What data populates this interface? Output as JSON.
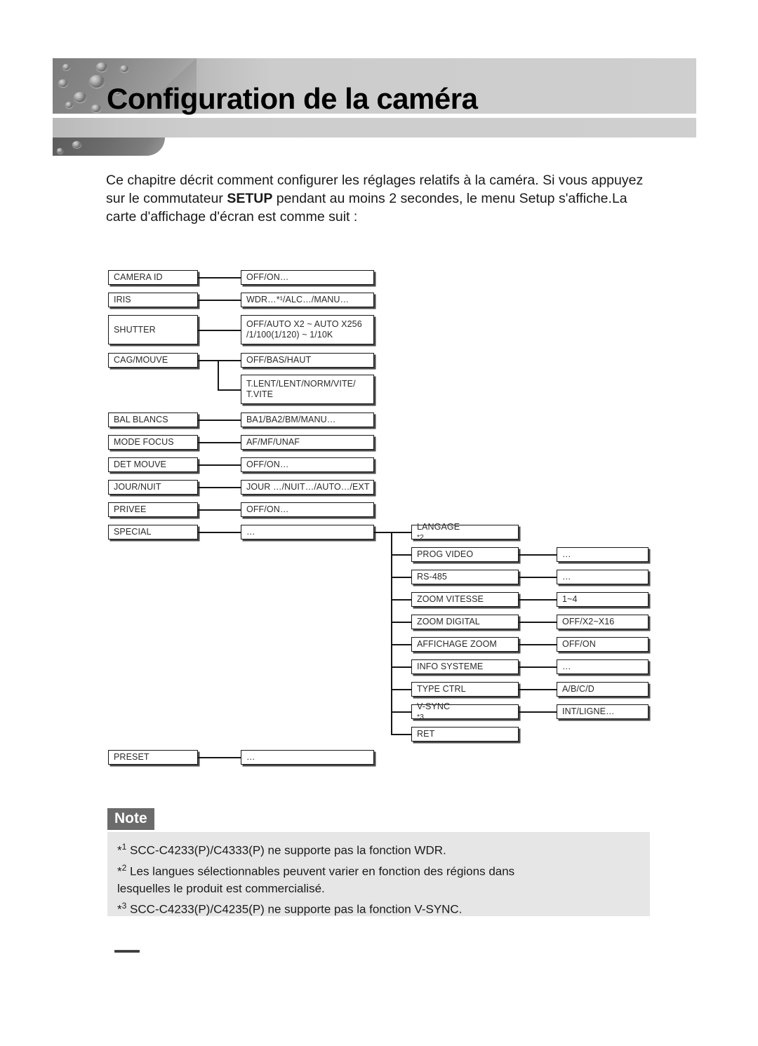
{
  "header": {
    "title": "Configuration de la caméra"
  },
  "intro": {
    "line1": "Ce chapitre décrit comment configurer les réglages relatifs à la caméra.",
    "line2_pre": "Si vous appuyez sur le commutateur ",
    "line2_bold": "SETUP",
    "line2_post": " pendant au moins 2",
    "line3": "secondes, le menu Setup s'affiche.La carte d'affichage d'écran est comme",
    "line4": "suit :"
  },
  "diagram": {
    "menu_items": [
      {
        "label": "CAMERA ID",
        "value": "OFF/ON…"
      },
      {
        "label": "IRIS",
        "value": "WDR…*¹/ALC…/MANU…"
      },
      {
        "label": "SHUTTER",
        "value": "OFF/AUTO X2 ~ AUTO X256\n/1/100(1/120) ~ 1/10K"
      },
      {
        "label": "CAG/MOUVE",
        "value": "OFF/BAS/HAUT",
        "value2": "T.LENT/LENT/NORM/VITE/\nT.VITE"
      },
      {
        "label": "BAL BLANCS",
        "value": "BA1/BA2/BM/MANU…"
      },
      {
        "label": "MODE FOCUS",
        "value": "AF/MF/UNAF"
      },
      {
        "label": "DET MOUVE",
        "value": "OFF/ON…"
      },
      {
        "label": "JOUR/NUIT",
        "value": "JOUR …/NUIT…/AUTO…/EXT"
      },
      {
        "label": "PRIVEE",
        "value": "OFF/ON…"
      },
      {
        "label": "SPECIAL",
        "value": "…"
      },
      {
        "label": "PRESET",
        "value": "…"
      }
    ],
    "special_submenu": [
      {
        "label": "LANGAGE *2",
        "note": "2",
        "value": null
      },
      {
        "label": "PROG VIDEO",
        "value": "…"
      },
      {
        "label": "RS-485",
        "value": "…"
      },
      {
        "label": "ZOOM VITESSE",
        "value": "1~4"
      },
      {
        "label": "ZOOM DIGITAL",
        "value": "OFF/X2~X16"
      },
      {
        "label": "AFFICHAGE ZOOM",
        "value": "OFF/ON"
      },
      {
        "label": "INFO SYSTEME",
        "value": "…"
      },
      {
        "label": "TYPE CTRL",
        "value": "A/B/C/D"
      },
      {
        "label": "V-SYNC *3",
        "note": "3",
        "value": "INT/LIGNE…"
      },
      {
        "label": "RET",
        "value": null
      }
    ]
  },
  "note": {
    "label": "Note",
    "items": [
      "*1 SCC-C4233(P)/C4333(P) ne supporte pas la fonction WDR.",
      "*2 Les langues sélectionnables peuvent varier en fonction des régions dans",
      "lesquelles le produit est commercialisé.",
      "*3 SCC-C4233(P)/C4235(P) ne supporte pas la fonction V-SYNC."
    ]
  },
  "colors": {
    "note_label_bg": "#6b6b6b",
    "note_body_bg": "#e6e6e6",
    "header_gray": "#cfcfcf",
    "box_border": "#161616",
    "box_shadow": "#4a4a4a"
  }
}
